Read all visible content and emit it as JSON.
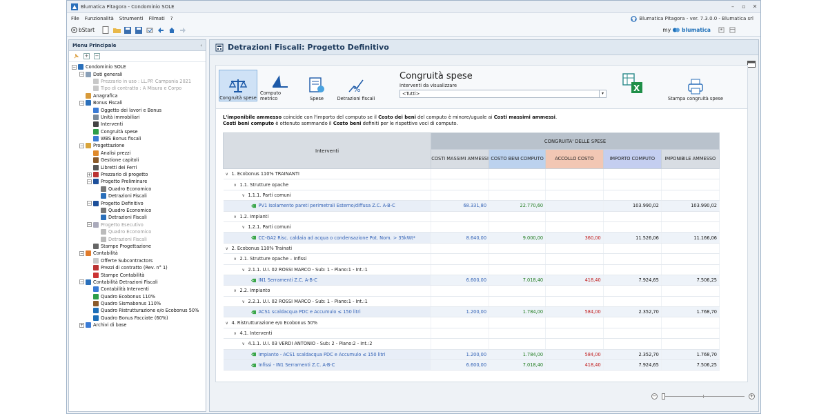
{
  "window": {
    "title": "Blumatica Pitagora - Condominio SOLE",
    "version": "Blumatica Pitagora - ver. 7.3.0.0 - Blumatica srl"
  },
  "menu": [
    "File",
    "Funzionalità",
    "Strumenti",
    "Filmati",
    "?"
  ],
  "toolbar": {
    "bstart": "bStart",
    "my": "my",
    "blumatica": "blumatica"
  },
  "left_panel": {
    "title": "Menu Principale",
    "tree": [
      {
        "label": "Condominio SOLE",
        "level": 0,
        "exp": "-",
        "color": "#2a6fba"
      },
      {
        "label": "Dati generali",
        "level": 1,
        "exp": "-",
        "color": "#8aa0b8"
      },
      {
        "label": "Prezzario in uso : LL.PP. Campania 2021",
        "level": 2,
        "exp": "",
        "color": "#c8c8c8",
        "grey": true
      },
      {
        "label": "Tipo di contratto : A Misura e Corpo",
        "level": 2,
        "exp": "",
        "color": "#c8c8c8",
        "grey": true
      },
      {
        "label": "Anagrafica",
        "level": 1,
        "exp": "",
        "color": "#d89a3a"
      },
      {
        "label": "Bonus Fiscali",
        "level": 1,
        "exp": "-",
        "color": "#2a6fba"
      },
      {
        "label": "Oggetto dei lavori e Bonus",
        "level": 2,
        "exp": "",
        "color": "#3a7bd5"
      },
      {
        "label": "Unità immobiliari",
        "level": 2,
        "exp": "",
        "color": "#7a8a9a"
      },
      {
        "label": "Interventi",
        "level": 2,
        "exp": "",
        "color": "#444"
      },
      {
        "label": "Congruità spese",
        "level": 2,
        "exp": "",
        "color": "#2e9e4a"
      },
      {
        "label": "WBS Bonus fiscali",
        "level": 2,
        "exp": "",
        "color": "#3a7bd5"
      },
      {
        "label": "Progettazione",
        "level": 1,
        "exp": "-",
        "color": "#d8a43a"
      },
      {
        "label": "Analisi prezzi",
        "level": 2,
        "exp": "",
        "color": "#e0892a"
      },
      {
        "label": "Gestione capitoli",
        "level": 2,
        "exp": "",
        "color": "#8a5a2a"
      },
      {
        "label": "Libretti dei Ferri",
        "level": 2,
        "exp": "",
        "color": "#555"
      },
      {
        "label": "Prezzario di progetto",
        "level": 2,
        "exp": "+",
        "color": "#b33"
      },
      {
        "label": "Progetto Preliminare",
        "level": 2,
        "exp": "-",
        "color": "#1d4f9a"
      },
      {
        "label": "Quadro Economico",
        "level": 3,
        "exp": "",
        "color": "#777"
      },
      {
        "label": "Detrazioni Fiscali",
        "level": 3,
        "exp": "",
        "color": "#2a6fba"
      },
      {
        "label": "Progetto Definitivo",
        "level": 2,
        "exp": "-",
        "color": "#1d4f9a"
      },
      {
        "label": "Quadro Economico",
        "level": 3,
        "exp": "",
        "color": "#777"
      },
      {
        "label": "Detrazioni Fiscali",
        "level": 3,
        "exp": "",
        "color": "#2a6fba"
      },
      {
        "label": "Progetto Esecutivo",
        "level": 2,
        "exp": "-",
        "color": "#aab",
        "grey": true
      },
      {
        "label": "Quadro Economico",
        "level": 3,
        "exp": "",
        "color": "#bbb",
        "grey": true
      },
      {
        "label": "Detrazioni Fiscali",
        "level": 3,
        "exp": "",
        "color": "#bbb",
        "grey": true
      },
      {
        "label": "Stampe Progettazione",
        "level": 2,
        "exp": "",
        "color": "#666"
      },
      {
        "label": "Contabilità",
        "level": 1,
        "exp": "-",
        "color": "#e07a2a"
      },
      {
        "label": "Offerte Subcontractors",
        "level": 2,
        "exp": "",
        "color": "#c8c8c8"
      },
      {
        "label": "Prezzi di contratto (Rev. n° 1)",
        "level": 2,
        "exp": "",
        "color": "#b33"
      },
      {
        "label": "Stampe Contabilità",
        "level": 2,
        "exp": "",
        "color": "#c33"
      },
      {
        "label": "Contabilità Detrazioni Fiscali",
        "level": 1,
        "exp": "-",
        "color": "#2a6fba"
      },
      {
        "label": "Contabilità Interventi",
        "level": 2,
        "exp": "",
        "color": "#3a7bd5"
      },
      {
        "label": "Quadro Ecobonus 110%",
        "level": 2,
        "exp": "",
        "color": "#2e9e4a"
      },
      {
        "label": "Quadro Sismabonus 110%",
        "level": 2,
        "exp": "",
        "color": "#8a5a2a"
      },
      {
        "label": "Quadro Ristrutturazione e/o Ecobonus 50%",
        "level": 2,
        "exp": "",
        "color": "#1d6fb8"
      },
      {
        "label": "Quadro Bonus Facciate (60%)",
        "level": 2,
        "exp": "",
        "color": "#1d6fb8"
      },
      {
        "label": "Archivi di base",
        "level": 1,
        "exp": "+",
        "color": "#3a7bd5"
      }
    ]
  },
  "content": {
    "header": "Detrazioni Fiscali: Progetto Definitivo",
    "ribbon": [
      {
        "label": "Congruità spese",
        "active": true
      },
      {
        "label": "Computo metrico",
        "active": false
      },
      {
        "label": "Spese",
        "active": false
      },
      {
        "label": "Detrazioni fiscali",
        "active": false
      }
    ],
    "congruita_title": "Congruità spese",
    "filter_label": "Interventi da visualizzare",
    "filter_value": "<Tutti>",
    "print_label": "Stampa congruità spese",
    "info": {
      "l1_a": "L'imponibile ammesso",
      "l1_b": " coincide con l'importo del computo se il ",
      "l1_c": "Costo dei beni",
      "l1_d": " del computo è minore/uguale ai ",
      "l1_e": "Costi massimi ammessi",
      "l1_f": ".",
      "l2_a": "Costi beni computo",
      "l2_b": " è ottenuto sommando il ",
      "l2_c": "Costo beni",
      "l2_d": " definiti per le rispettive voci di computo."
    },
    "table": {
      "col_interventi": "Interventi",
      "group_header": "CONGRUITA' DELLE SPESE",
      "columns": [
        "COSTI MASSIMI AMMESSI",
        "COSTO BENI COMPUTO",
        "ACCOLLO COSTO",
        "IMPORTO COMPUTO",
        "IMPONIBILE AMMESSO"
      ],
      "rows": [
        {
          "indent": 0,
          "caret": "∨",
          "name": "1. Ecobonus 110% TRAINANTI",
          "leaf": false,
          "v": [
            "",
            "",
            "",
            "",
            ""
          ]
        },
        {
          "indent": 1,
          "caret": "∨",
          "name": "1.1. Strutture opache",
          "leaf": false,
          "v": [
            "",
            "",
            "",
            "",
            ""
          ]
        },
        {
          "indent": 2,
          "caret": "∨",
          "name": "1.1.1. Parti comuni",
          "leaf": false,
          "v": [
            "",
            "",
            "",
            "",
            ""
          ]
        },
        {
          "indent": 3,
          "caret": "",
          "name": "PV1 Isolamento pareti perimetrali Esterno/diffusa Z.C. A-B-C",
          "leaf": true,
          "v": [
            "68.331,80",
            "22.770,60",
            "",
            "103.990,02",
            "103.990,02"
          ]
        },
        {
          "indent": 1,
          "caret": "∨",
          "name": "1.2. Impianti",
          "leaf": false,
          "v": [
            "",
            "",
            "",
            "",
            ""
          ]
        },
        {
          "indent": 2,
          "caret": "∨",
          "name": "1.2.1. Parti comuni",
          "leaf": false,
          "v": [
            "",
            "",
            "",
            "",
            ""
          ]
        },
        {
          "indent": 3,
          "caret": "",
          "name": "CC-GA2 Risc. caldaia ad acqua o condensazione Pot. Nom. > 35kWt*",
          "leaf": true,
          "v": [
            "8.640,00",
            "9.000,00",
            "360,00",
            "11.526,06",
            "11.166,06"
          ]
        },
        {
          "indent": 0,
          "caret": "∨",
          "name": "2. Ecobonus 110% Trainati",
          "leaf": false,
          "v": [
            "",
            "",
            "",
            "",
            ""
          ]
        },
        {
          "indent": 1,
          "caret": "∨",
          "name": "2.1. Strutture opache – Infissi",
          "leaf": false,
          "v": [
            "",
            "",
            "",
            "",
            ""
          ]
        },
        {
          "indent": 2,
          "caret": "∨",
          "name": "2.1.1. U.I. 02 ROSSI MARCO - Sub: 1 - Piano:1 - Int.:1",
          "leaf": false,
          "v": [
            "",
            "",
            "",
            "",
            ""
          ]
        },
        {
          "indent": 3,
          "caret": "",
          "name": "IN1 Serramenti Z.C. A-B-C",
          "leaf": true,
          "v": [
            "6.600,00",
            "7.018,40",
            "418,40",
            "7.924,65",
            "7.506,25"
          ]
        },
        {
          "indent": 1,
          "caret": "∨",
          "name": "2.2. Impianto",
          "leaf": false,
          "v": [
            "",
            "",
            "",
            "",
            ""
          ]
        },
        {
          "indent": 2,
          "caret": "∨",
          "name": "2.2.1. U.I. 02 ROSSI MARCO - Sub: 1 - Piano:1 - Int.:1",
          "leaf": false,
          "v": [
            "",
            "",
            "",
            "",
            ""
          ]
        },
        {
          "indent": 3,
          "caret": "",
          "name": "ACS1 scaldacqua PDC e Accumulo ≤ 150 litri",
          "leaf": true,
          "v": [
            "1.200,00",
            "1.784,00",
            "584,00",
            "2.352,70",
            "1.768,70"
          ]
        },
        {
          "indent": 0,
          "caret": "∨",
          "name": "4. Ristrutturazione e/o Ecobonus 50%",
          "leaf": false,
          "v": [
            "",
            "",
            "",
            "",
            ""
          ]
        },
        {
          "indent": 1,
          "caret": "∨",
          "name": "4.1. Interventi",
          "leaf": false,
          "v": [
            "",
            "",
            "",
            "",
            ""
          ]
        },
        {
          "indent": 2,
          "caret": "∨",
          "name": "4.1.1. U.I. 03 VERDI ANTONIO - Sub: 2 - Piano:2 - Int.:2",
          "leaf": false,
          "v": [
            "",
            "",
            "",
            "",
            ""
          ]
        },
        {
          "indent": 3,
          "caret": "",
          "name": "Impianto - ACS1 scaldacqua PDC e Accumulo ≤ 150 litri",
          "leaf": true,
          "v": [
            "1.200,00",
            "1.784,00",
            "584,00",
            "2.352,70",
            "1.768,70"
          ]
        },
        {
          "indent": 3,
          "caret": "",
          "name": "Infissi - IN1 Serramenti Z.C. A-B-C",
          "leaf": true,
          "v": [
            "6.600,00",
            "7.018,40",
            "418,40",
            "7.924,65",
            "7.506,25"
          ]
        }
      ]
    }
  },
  "colors": {
    "accent": "#1d6fb8",
    "header_text": "#1d3a5c",
    "tag_green": "#3aa64a"
  }
}
